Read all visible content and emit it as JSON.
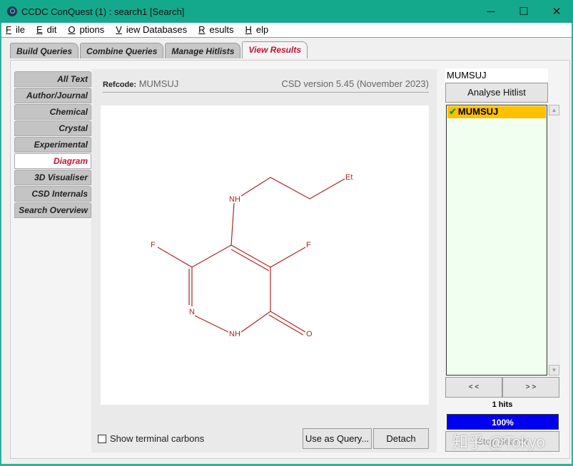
{
  "window": {
    "title": "CCDC ConQuest (1) : search1 [Search]",
    "minimize": "─",
    "maximize": "☐",
    "close": "✕"
  },
  "menu": [
    {
      "k": "F",
      "r": "ile"
    },
    {
      "k": "E",
      "r": "dit"
    },
    {
      "k": "O",
      "r": "ptions"
    },
    {
      "k": "V",
      "r": "iew Databases"
    },
    {
      "k": "R",
      "r": "esults"
    },
    {
      "k": "H",
      "r": "elp"
    }
  ],
  "tabs": [
    "Build Queries",
    "Combine Queries",
    "Manage Hitlists",
    "View Results"
  ],
  "active_tab": "View Results",
  "side_tabs": [
    "All Text",
    "Author/Journal",
    "Chemical",
    "Crystal",
    "Experimental",
    "Diagram",
    "3D Visualiser",
    "CSD Internals",
    "Search Overview"
  ],
  "active_side_tab": "Diagram",
  "refcode_label": "Refcode:",
  "refcode": "MUMSUJ",
  "csd_version": "CSD version 5.45 (November 2023)",
  "molecule": {
    "atoms": {
      "nh1": "NH",
      "et": "Et",
      "f1": "F",
      "f2": "F",
      "n": "N",
      "nh2": "NH",
      "o": "O"
    },
    "bond_color": "#b22222"
  },
  "show_terminal_carbons": {
    "label": "Show terminal carbons",
    "checked": false
  },
  "buttons": {
    "use_as_query": "Use as Query...",
    "detach": "Detach",
    "analyse": "Analyse Hitlist",
    "prev": "< <",
    "next": "> >",
    "stop": "Stop Search"
  },
  "hitlist": {
    "input": "MUMSUJ",
    "items": [
      {
        "name": "MUMSUJ",
        "checked": true
      }
    ],
    "hits": "1 hits",
    "progress": "100%",
    "progress_value": 100
  },
  "watermark": "知乎 @Tokyo"
}
